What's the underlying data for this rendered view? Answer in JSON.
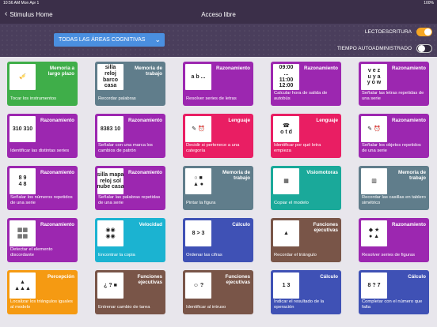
{
  "status": {
    "time": "10:56 AM",
    "date": "Mon Apr 1",
    "battery": "100%"
  },
  "nav": {
    "back_label": "Stimulus Home",
    "title": "Acceso libre"
  },
  "filter": {
    "dropdown_value": "TODAS LAS ÁREAS COGNITIVAS",
    "toggle1_label": "LECTOESCRITURA",
    "toggle1_on": true,
    "toggle2_label": "TIEMPO AUTOADMINISTRADO",
    "toggle2_on": false
  },
  "cards": [
    {
      "cat": "Memoria a largo plazo",
      "name": "Tocar los instrumentos",
      "color": "green",
      "thumb": "🎺"
    },
    {
      "cat": "Memoria de trabajo",
      "name": "Recordar palabras",
      "color": "slate",
      "thumb": "silla\nreloj\nbarco\ncasa"
    },
    {
      "cat": "Razonamiento",
      "name": "Resolver series de letras",
      "color": "purple",
      "thumb": "a b ..."
    },
    {
      "cat": "Razonamiento",
      "name": "Calcular hora de salida de autobús",
      "color": "purple",
      "thumb": "09:00\n...\n11:00\n12:00"
    },
    {
      "cat": "Razonamiento",
      "name": "Señalar las letras repetidas de una serie",
      "color": "purple",
      "thumb": "v e z\nu y a\ny o w"
    },
    {
      "cat": "Razonamiento",
      "name": "Identificar las distintas series",
      "color": "purple",
      "thumb": "310 310"
    },
    {
      "cat": "Razonamiento",
      "name": "Señalar con una marca los cambios de patrón",
      "color": "purple",
      "thumb": "8383 10"
    },
    {
      "cat": "Lenguaje",
      "name": "Decidir si pertenece a una categoría",
      "color": "magenta",
      "thumb": "✎ ⏰"
    },
    {
      "cat": "Lenguaje",
      "name": "Identificar por qué letra empieza",
      "color": "magenta",
      "thumb": "☎\no t d"
    },
    {
      "cat": "Razonamiento",
      "name": "Señalar los objetos repetidos de una serie",
      "color": "purple",
      "thumb": "✎ ⏰"
    },
    {
      "cat": "Razonamiento",
      "name": "Señalar los números repetidos de una serie",
      "color": "purple",
      "thumb": "8 9\n4 8"
    },
    {
      "cat": "Razonamiento",
      "name": "Señalar las palabras repetidas de una serie",
      "color": "purple",
      "thumb": "silla mapa\nreloj sol\nnube casa"
    },
    {
      "cat": "Memoria de trabajo",
      "name": "Pintar la figura",
      "color": "slate",
      "thumb": "○ ■\n▲ ●"
    },
    {
      "cat": "Visiomotoras",
      "name": "Copiar el modelo",
      "color": "teal",
      "thumb": "▦"
    },
    {
      "cat": "Memoria de trabajo",
      "name": "Recordar las casillas en tablero simétrico",
      "color": "slate",
      "thumb": "▥"
    },
    {
      "cat": "Razonamiento",
      "name": "Detectar el elemento discordante",
      "color": "purple",
      "thumb": "▦▦\n▦▦"
    },
    {
      "cat": "Velocidad",
      "name": "Encontrar la copia",
      "color": "cyan",
      "thumb": "◉◉\n◉◉"
    },
    {
      "cat": "Cálculo",
      "name": "Ordenar las cifras",
      "color": "indigo",
      "thumb": "8 > 3"
    },
    {
      "cat": "Funciones ejecutivas",
      "name": "Recordar el triángulo",
      "color": "brown",
      "thumb": "▲"
    },
    {
      "cat": "Razonamiento",
      "name": "Resolver series de figuras",
      "color": "purple",
      "thumb": "◆ ★\n● ▲"
    },
    {
      "cat": "Percepción",
      "name": "Localizar los triángulos iguales al modelo",
      "color": "orange",
      "thumb": "▲\n▲▲▲"
    },
    {
      "cat": "Funciones ejecutivas",
      "name": "Entrenar cambio de tarea",
      "color": "brown",
      "thumb": "¿ ? ■"
    },
    {
      "cat": "Funciones ejecutivas",
      "name": "Identificar al intruso",
      "color": "brown",
      "thumb": "☺ ?"
    },
    {
      "cat": "Cálculo",
      "name": "Indicar el resultado de la operación",
      "color": "indigo",
      "thumb": "1 3"
    },
    {
      "cat": "Cálculo",
      "name": "Completar con el número que falta",
      "color": "indigo",
      "thumb": "8 ? 7"
    }
  ]
}
